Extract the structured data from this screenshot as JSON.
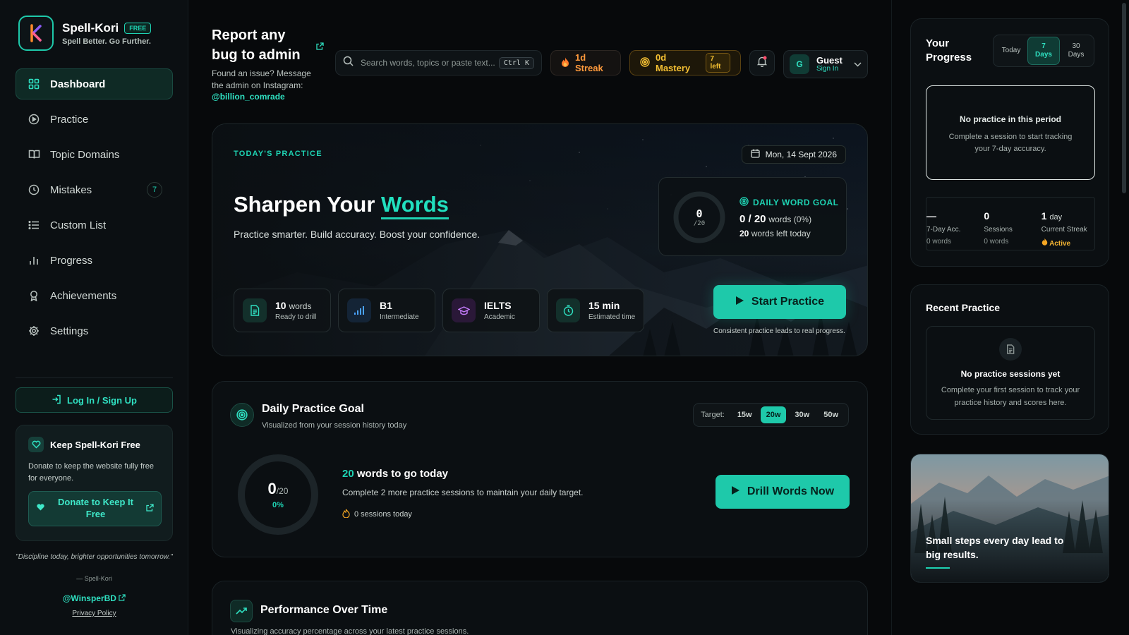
{
  "brand": {
    "name": "Spell-Kori",
    "badge": "FREE",
    "tagline": "Spell Better. Go Further."
  },
  "sidebar": {
    "items": [
      {
        "label": "Dashboard",
        "icon": "dashboard-icon",
        "active": true
      },
      {
        "label": "Practice",
        "icon": "play-circle-icon"
      },
      {
        "label": "Topic Domains",
        "icon": "book-icon"
      },
      {
        "label": "Mistakes",
        "icon": "clock-icon",
        "count": "7"
      },
      {
        "label": "Custom List",
        "icon": "list-icon"
      },
      {
        "label": "Progress",
        "icon": "bar-chart-icon"
      },
      {
        "label": "Achievements",
        "icon": "award-icon"
      },
      {
        "label": "Settings",
        "icon": "gear-icon"
      }
    ],
    "login_label": "Log In / Sign Up",
    "donate": {
      "title": "Keep Spell-Kori Free",
      "desc": "Donate to keep the website fully free for everyone.",
      "button": "Donate to Keep It Free"
    },
    "quote": "\"Discipline today, brighter opportunities tomorrow.\"",
    "quote_author": "— Spell-Kori",
    "handle": "@WinsperBD",
    "privacy": "Privacy Policy"
  },
  "report": {
    "title": "Report any bug to admin",
    "desc": "Found an issue? Message the admin on Instagram:",
    "handle": "@billion_comrade"
  },
  "search": {
    "placeholder": "Search words, topics or paste text...",
    "shortcut": "Ctrl K"
  },
  "header": {
    "streak": "1d Streak",
    "mastery": "0d Mastery",
    "mastery_left": "7 left",
    "user_initial": "G",
    "user_name": "Guest",
    "user_action": "Sign In"
  },
  "hero": {
    "eyebrow": "TODAY'S PRACTICE",
    "date": "Mon, 14 Sept 2026",
    "title_prefix": "Sharpen Your",
    "title_highlight": "Words",
    "subtitle": "Practice smarter. Build accuracy. Boost your confidence.",
    "goal": {
      "label": "DAILY WORD GOAL",
      "ring_value": "0",
      "ring_total": "/20",
      "count": "0 / 20",
      "count_suffix": "words (0%)",
      "left_num": "20",
      "left_text": "words left today"
    },
    "stats": [
      {
        "main": "10",
        "main_suffix": "words",
        "sub": "Ready to drill",
        "icon": "document-icon"
      },
      {
        "main": "B1",
        "main_suffix": "",
        "sub": "Intermediate",
        "icon": "signal-bars-icon"
      },
      {
        "main": "IELTS",
        "main_suffix": "",
        "sub": "Academic",
        "icon": "graduation-cap-icon"
      },
      {
        "main": "15 min",
        "main_suffix": "",
        "sub": "Estimated time",
        "icon": "timer-icon"
      }
    ],
    "start_button": "Start Practice",
    "note": "Consistent practice leads to real progress."
  },
  "daily_goal": {
    "title": "Daily Practice Goal",
    "subtitle": "Visualized from your session history today",
    "target_label": "Target:",
    "targets": [
      "15w",
      "20w",
      "30w",
      "50w"
    ],
    "selected_target": "20w",
    "ring_value": "0",
    "ring_total": "/20",
    "ring_percent": "0%",
    "progress": 0,
    "togo_num": "20",
    "togo_text": "words to go today",
    "message": "Complete 2 more practice sessions to maintain your daily target.",
    "sessions": "0 sessions today",
    "drill_button": "Drill Words Now"
  },
  "performance": {
    "title": "Performance Over Time",
    "subtitle": "Visualizing accuracy percentage across your latest practice sessions."
  },
  "your_progress": {
    "title": "Your Progress",
    "tabs": [
      "Today",
      "7 Days",
      "30 Days"
    ],
    "selected_tab": "7 Days",
    "empty_title": "No practice in this period",
    "empty_desc": "Complete a session to start tracking your 7-day accuracy.",
    "stats": [
      {
        "value": "—",
        "unit": "",
        "label": "7-Day Acc.",
        "sub": "0 words"
      },
      {
        "value": "0",
        "unit": "",
        "label": "Sessions",
        "sub": "0 words"
      },
      {
        "value": "1",
        "unit": "day",
        "label": "Current Streak",
        "sub": "Active"
      }
    ]
  },
  "recent": {
    "title": "Recent Practice",
    "empty_title": "No practice sessions yet",
    "empty_desc": "Complete your first session to track your practice history and scores here."
  },
  "motto": {
    "text": "Small steps every day lead to big results."
  },
  "colors": {
    "accent": "#1ec9aa",
    "streak": "#ff9a3c",
    "mastery": "#f5c033",
    "background": "#07090b"
  }
}
